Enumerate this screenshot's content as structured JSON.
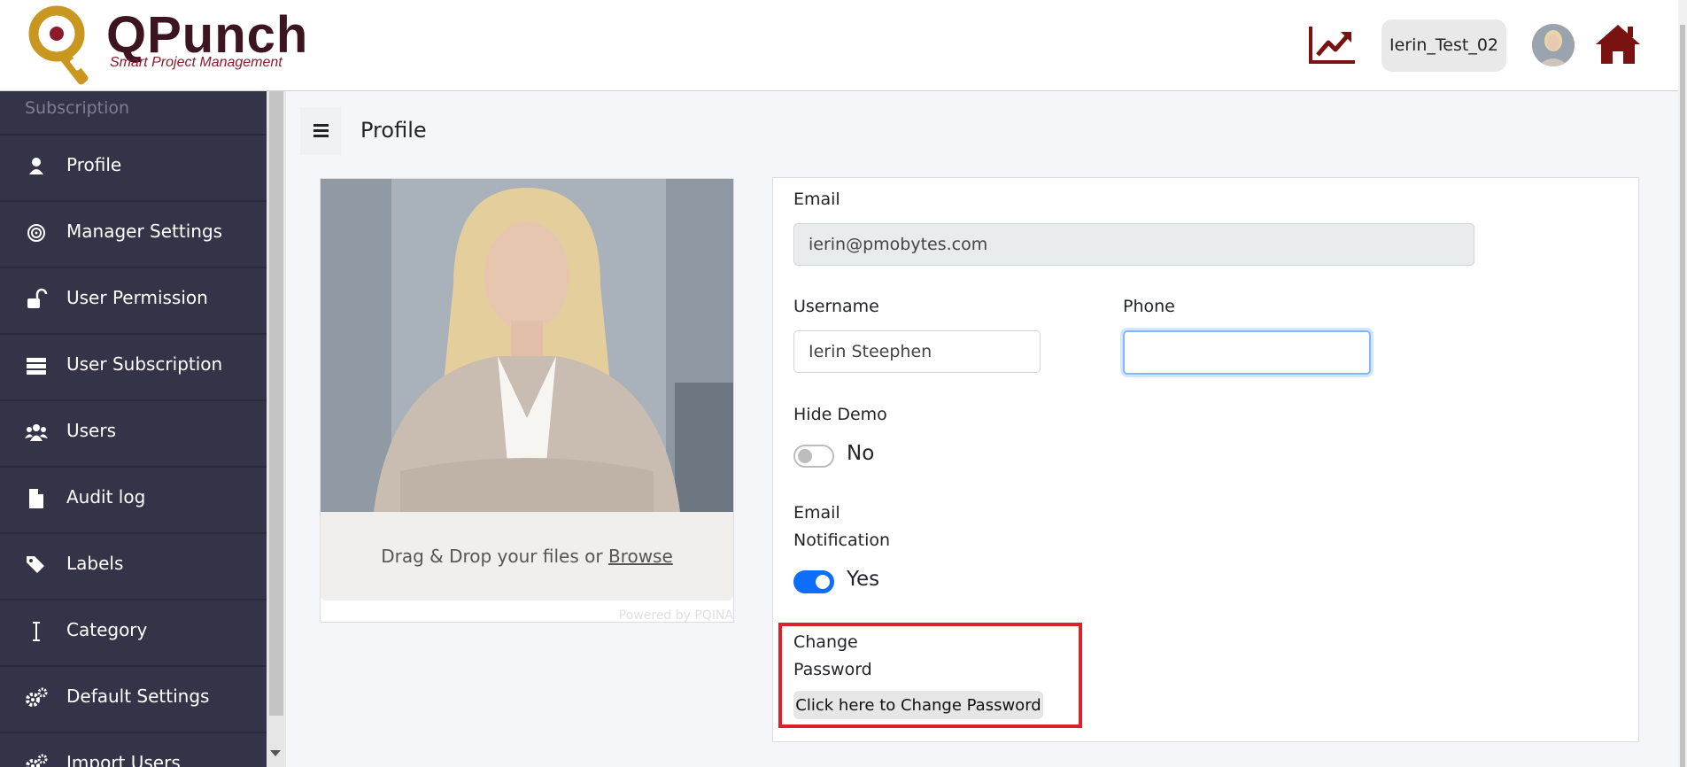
{
  "brand": {
    "name": "QPunch",
    "tagline": "Smart Project Management",
    "accent": "#8b1a2b",
    "logo_gold": "#c9971f"
  },
  "header": {
    "chart_icon": "trending-up-icon",
    "user_name": "Ierin_Test_02",
    "avatar": "user-avatar",
    "home_icon": "home-icon"
  },
  "sidebar": {
    "section_label": "Subscription",
    "items": [
      {
        "label": "Profile",
        "icon": "user-icon"
      },
      {
        "label": "Manager Settings",
        "icon": "fingerprint-icon"
      },
      {
        "label": "User Permission",
        "icon": "unlock-icon"
      },
      {
        "label": "User Subscription",
        "icon": "list-icon"
      },
      {
        "label": "Users",
        "icon": "users-icon"
      },
      {
        "label": "Audit log",
        "icon": "file-icon"
      },
      {
        "label": "Labels",
        "icon": "tags-icon"
      },
      {
        "label": "Category",
        "icon": "text-cursor-icon"
      },
      {
        "label": "Default Settings",
        "icon": "gears-icon"
      },
      {
        "label": "Import Users",
        "icon": "gears-icon"
      }
    ]
  },
  "page": {
    "title": "Profile"
  },
  "upload": {
    "drop_text": "Drag & Drop your files or ",
    "browse_link": "Browse",
    "powered_by": "Powered by PQINA"
  },
  "form": {
    "email_label": "Email",
    "email_value": "ierin@pmobytes.com",
    "username_label": "Username",
    "username_value": "Ierin Steephen",
    "phone_label": "Phone",
    "phone_value": "",
    "hide_demo_label": "Hide Demo",
    "hide_demo_value": "No",
    "email_notification_label_1": "Email",
    "email_notification_label_2": "Notification",
    "email_notification_value": "Yes",
    "change_password_label_1": "Change",
    "change_password_label_2": "Password",
    "change_password_button": "Click here to Change Password"
  }
}
